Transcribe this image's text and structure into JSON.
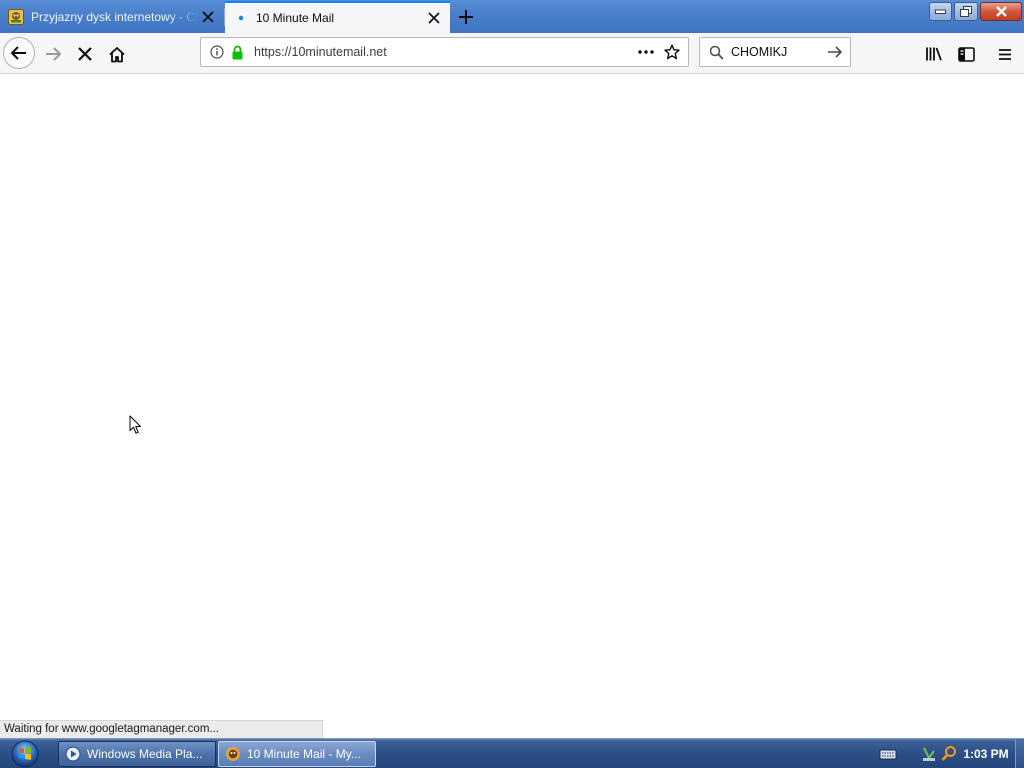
{
  "browser": {
    "tabs": [
      {
        "title": "Przyjazny dysk internetowy - Chomikuj.pl",
        "active": false
      },
      {
        "title": "10 Minute Mail",
        "active": true
      }
    ],
    "url": "https://10minutemail.net",
    "search": {
      "value": "CHOMIKJ"
    },
    "status_text": "Waiting for www.googletagmanager.com...",
    "accent_color": "#0a84ff",
    "secure_lock_color": "#12bc00"
  },
  "icons": {
    "back": "back-arrow-icon",
    "forward": "forward-arrow-icon",
    "stop": "stop-x-icon",
    "home": "home-icon",
    "info": "info-icon",
    "lock": "lock-icon",
    "page_actions": "ellipsis-icon",
    "bookmark": "star-icon",
    "search": "magnifier-icon",
    "library": "library-icon",
    "sidebar": "sidebar-icon",
    "menu": "hamburger-icon"
  },
  "taskbar": {
    "items": [
      {
        "label": "Windows Media Pla...",
        "icon": "windows-media-player-icon"
      },
      {
        "label": "10 Minute Mail - My...",
        "icon": "firefox-chomik-icon",
        "active": true
      }
    ],
    "clock": "1:03 PM"
  }
}
